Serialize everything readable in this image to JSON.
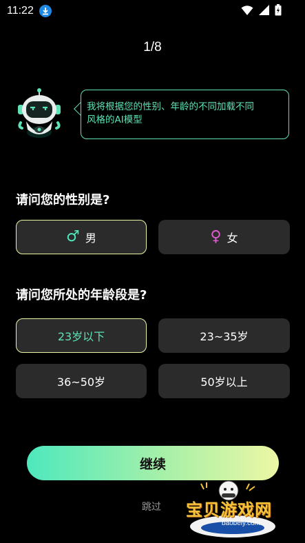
{
  "status_bar": {
    "time": "11:22",
    "icons": [
      "download-icon",
      "wifi-icon",
      "signal-icon",
      "battery-icon"
    ]
  },
  "progress": "1/8",
  "assistant": {
    "message_line1": "我将根据您的性别、年龄的不同加载不同",
    "message_line2": "风格的AI模型"
  },
  "gender": {
    "question": "请问您的性别是?",
    "options": [
      {
        "symbol": "♂",
        "label": "男",
        "selected": true
      },
      {
        "symbol": "♀",
        "label": "女",
        "selected": false
      }
    ]
  },
  "age": {
    "question": "请问您所处的年龄段是?",
    "options": [
      {
        "label": "23岁以下",
        "selected": true
      },
      {
        "label": "23~35岁",
        "selected": false
      },
      {
        "label": "36~50岁",
        "selected": false
      },
      {
        "label": "50岁以上",
        "selected": false
      }
    ]
  },
  "actions": {
    "continue_label": "继续",
    "skip_label": "跳过"
  },
  "watermark": {
    "name": "宝贝游戏网",
    "url": "baobeiy.com"
  },
  "colors": {
    "accent": "#5fe2b7",
    "selected_border": "#eef5a8",
    "male": "#4ee8bd",
    "female": "#e05ccf",
    "option_bg": "#2b2b2b"
  }
}
